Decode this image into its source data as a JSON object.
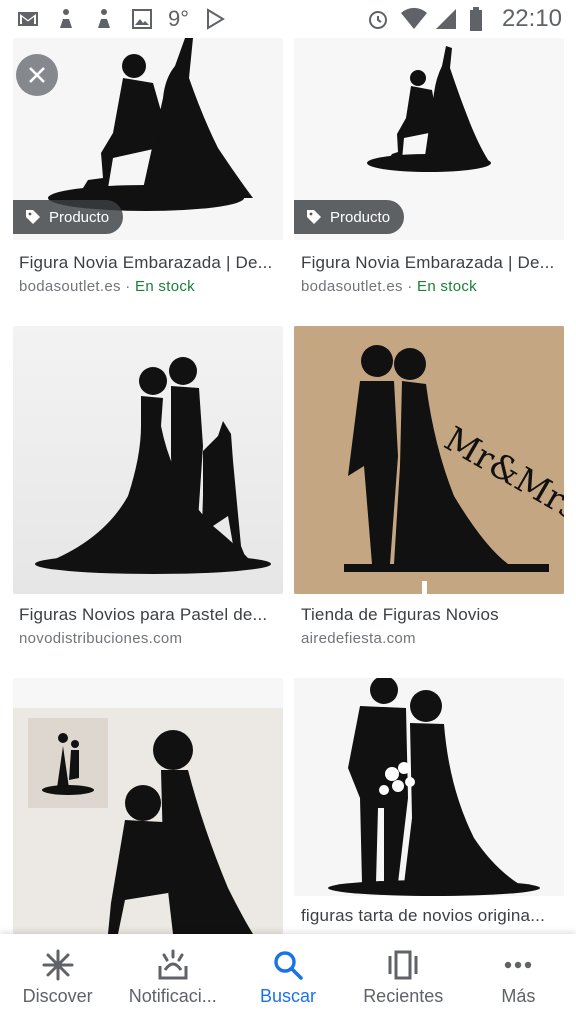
{
  "status_bar": {
    "time": "22:10",
    "temperature": "9°"
  },
  "results": [
    {
      "title": "Figura Novia Embarazada | De...",
      "source": "bodasoutlet.es",
      "stock": "En stock",
      "badge": "Producto"
    },
    {
      "title": "Figura Novia Embarazada | De...",
      "source": "bodasoutlet.es",
      "stock": "En stock",
      "badge": "Producto"
    },
    {
      "title": "Figuras Novios para Pastel de...",
      "source": "novodistribuciones.com"
    },
    {
      "title": "Tienda de Figuras Novios",
      "source": "airedefiesta.com"
    },
    {
      "title": "",
      "source": ""
    },
    {
      "title": "figuras tarta de novios origina...",
      "source": ""
    }
  ],
  "separator": " · ",
  "nav": {
    "items": [
      {
        "label": "Discover",
        "icon": "asterisk-icon"
      },
      {
        "label": "Notificaci...",
        "icon": "notifications-icon"
      },
      {
        "label": "Buscar",
        "icon": "search-icon"
      },
      {
        "label": "Recientes",
        "icon": "recents-icon"
      },
      {
        "label": "Más",
        "icon": "more-icon"
      }
    ]
  },
  "colors": {
    "accent": "#1a73e8",
    "stock": "#188038",
    "badge_bg": "#3c4043"
  }
}
